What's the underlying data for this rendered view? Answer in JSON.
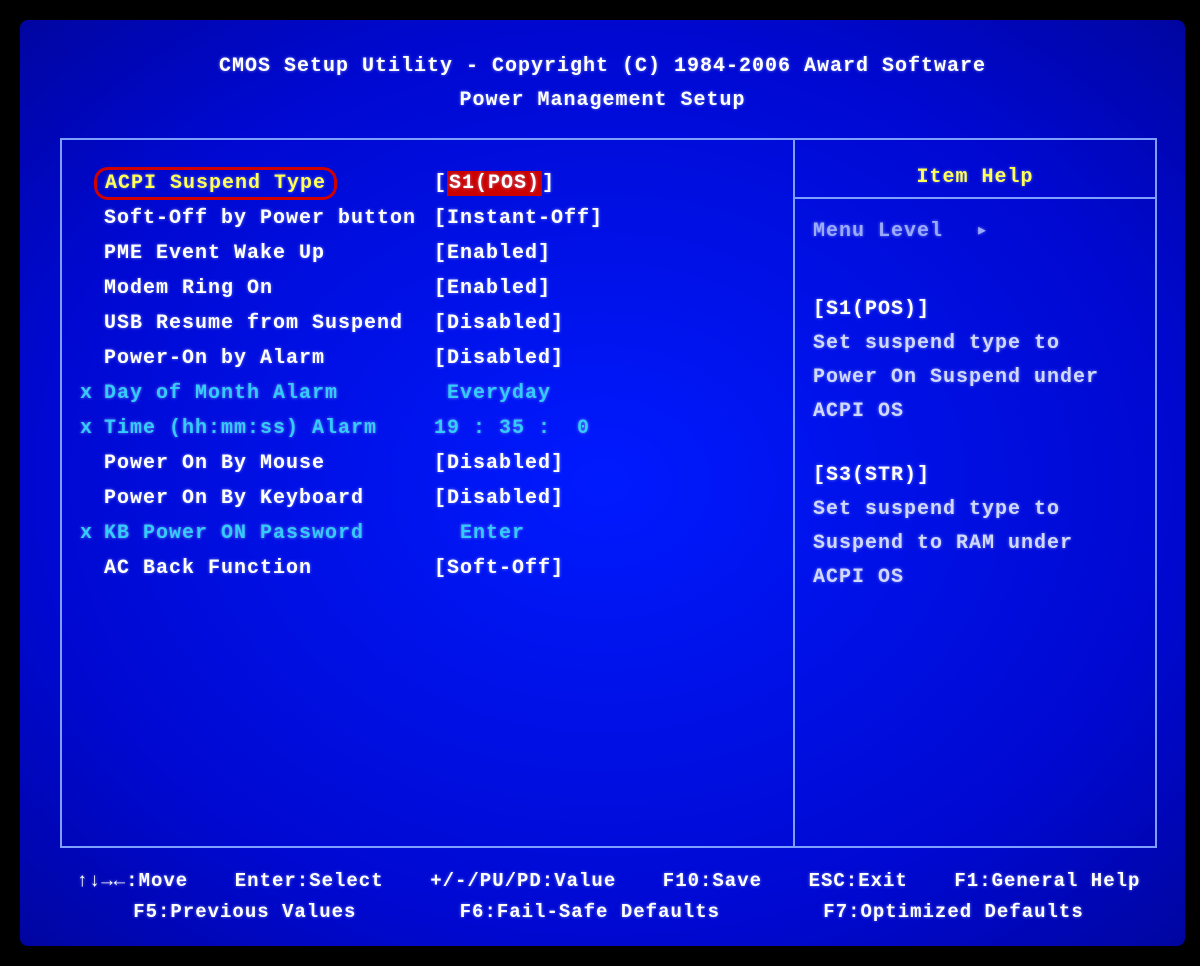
{
  "header": {
    "line1": "CMOS Setup Utility - Copyright (C) 1984-2006 Award Software",
    "line2": "Power Management Setup"
  },
  "items": [
    {
      "label": "ACPI Suspend Type",
      "value": "S1(POS)",
      "brackets": true,
      "selected": true,
      "disabled": false
    },
    {
      "label": "Soft-Off by Power button",
      "value": "Instant-Off",
      "brackets": true,
      "selected": false,
      "disabled": false
    },
    {
      "label": "PME Event Wake Up",
      "value": "Enabled",
      "brackets": true,
      "selected": false,
      "disabled": false
    },
    {
      "label": "Modem Ring On",
      "value": "Enabled",
      "brackets": true,
      "selected": false,
      "disabled": false
    },
    {
      "label": "USB Resume from Suspend",
      "value": "Disabled",
      "brackets": true,
      "selected": false,
      "disabled": false
    },
    {
      "label": "Power-On by Alarm",
      "value": "Disabled",
      "brackets": true,
      "selected": false,
      "disabled": false
    },
    {
      "label": "Day of Month Alarm",
      "value": " Everyday",
      "brackets": false,
      "selected": false,
      "disabled": true
    },
    {
      "label": "Time (hh:mm:ss) Alarm",
      "value": "19 : 35 :  0",
      "brackets": false,
      "selected": false,
      "disabled": true
    },
    {
      "label": "Power On By Mouse",
      "value": "Disabled",
      "brackets": true,
      "selected": false,
      "disabled": false
    },
    {
      "label": "Power On By Keyboard",
      "value": "Disabled",
      "brackets": true,
      "selected": false,
      "disabled": false
    },
    {
      "label": "KB Power ON Password",
      "value": "  Enter",
      "brackets": false,
      "selected": false,
      "disabled": true
    },
    {
      "label": "AC Back Function",
      "value": "Soft-Off",
      "brackets": true,
      "selected": false,
      "disabled": false
    }
  ],
  "help": {
    "title": "Item Help",
    "menu_level": "Menu Level",
    "blocks": [
      {
        "heading": "[S1(POS)]",
        "body": "Set suspend type to Power On Suspend under ACPI OS"
      },
      {
        "heading": "[S3(STR)]",
        "body": "Set suspend type to Suspend to RAM under ACPI OS"
      }
    ]
  },
  "footer": {
    "line1": [
      "↑↓→←:Move",
      "Enter:Select",
      "+/-/PU/PD:Value",
      "F10:Save",
      "ESC:Exit",
      "F1:General Help"
    ],
    "line2": [
      "F5:Previous Values",
      "F6:Fail-Safe Defaults",
      "F7:Optimized Defaults"
    ]
  }
}
